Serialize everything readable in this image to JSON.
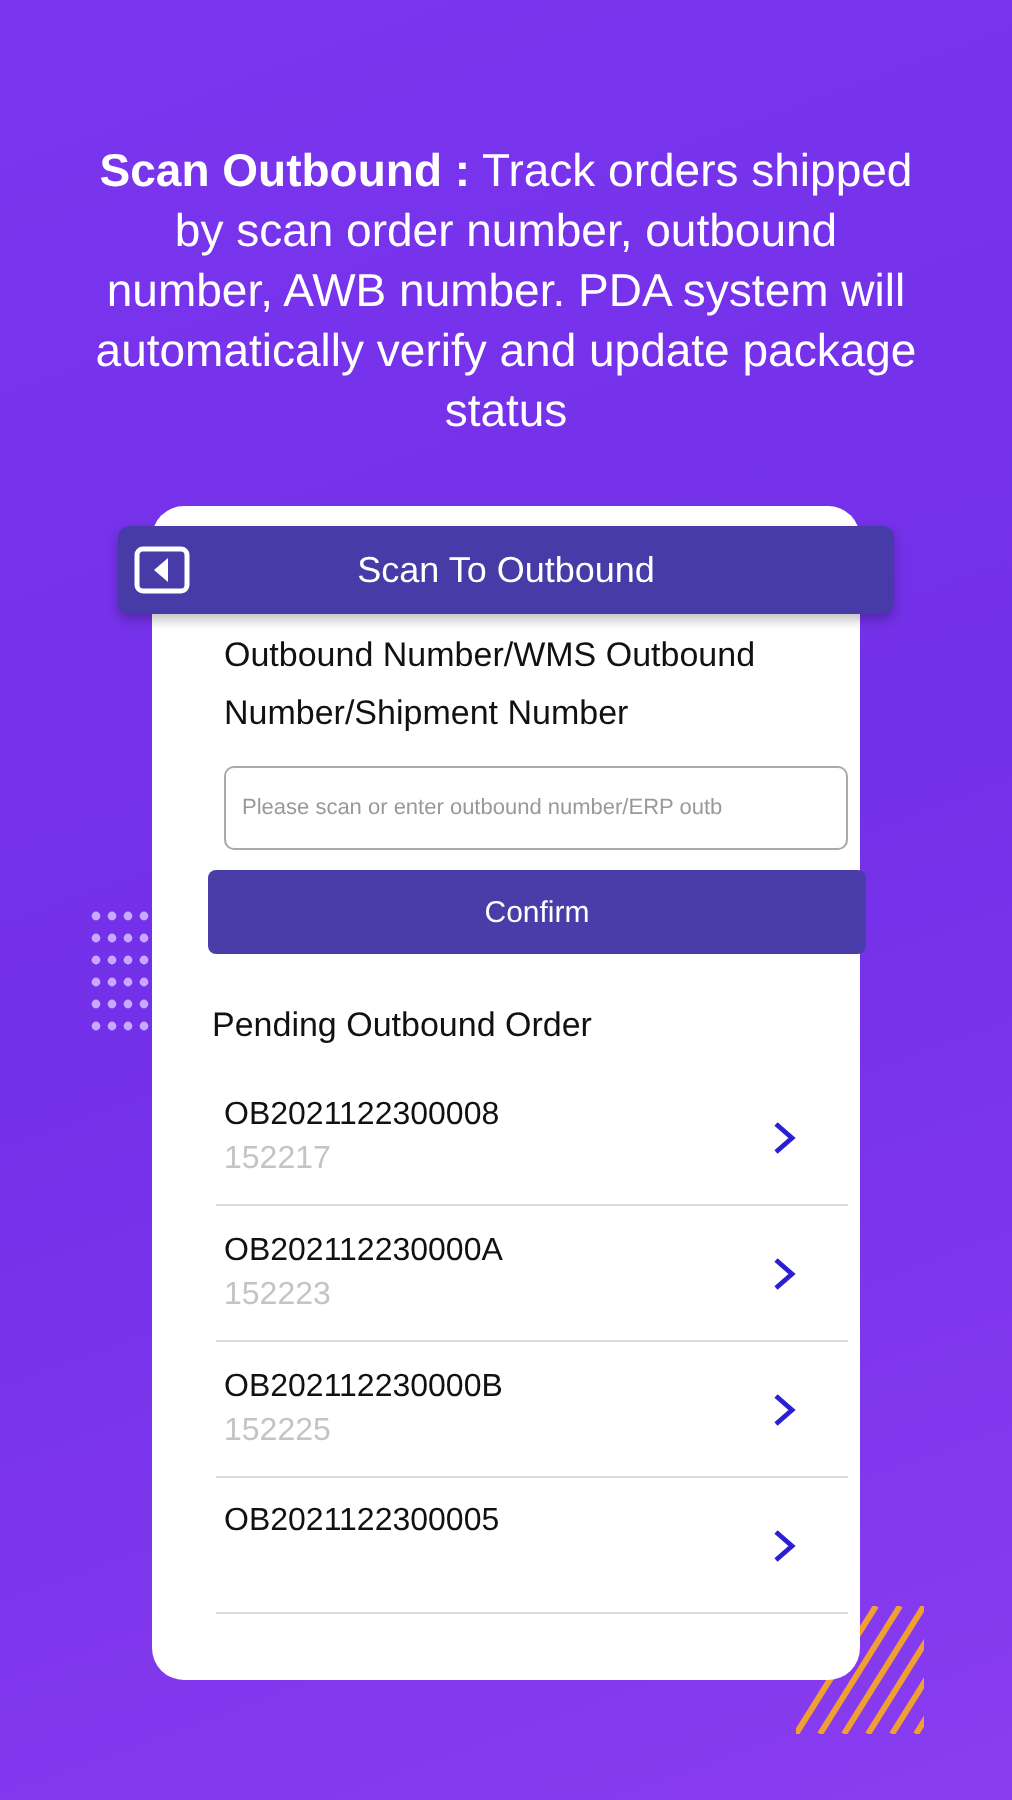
{
  "caption": "**Scan Outbound :** Track orders shipped by scan order number, outbound number, AWB number. PDA system will automatically verify and update package status",
  "header": {
    "title": "Scan To Outbound"
  },
  "field": {
    "label": "Outbound Number/WMS Outbound Number/Shipment Number",
    "placeholder": "Please scan or enter outbound number/ERP outb"
  },
  "confirm_button": "Confirm",
  "pending": {
    "title": "Pending Outbound Order",
    "orders": [
      {
        "number": "OB2021122300008",
        "code": "152217"
      },
      {
        "number": "OB202112230000A",
        "code": "152223"
      },
      {
        "number": "OB202112230000B",
        "code": "152225"
      },
      {
        "number": "OB2021122300005"
      }
    ]
  }
}
